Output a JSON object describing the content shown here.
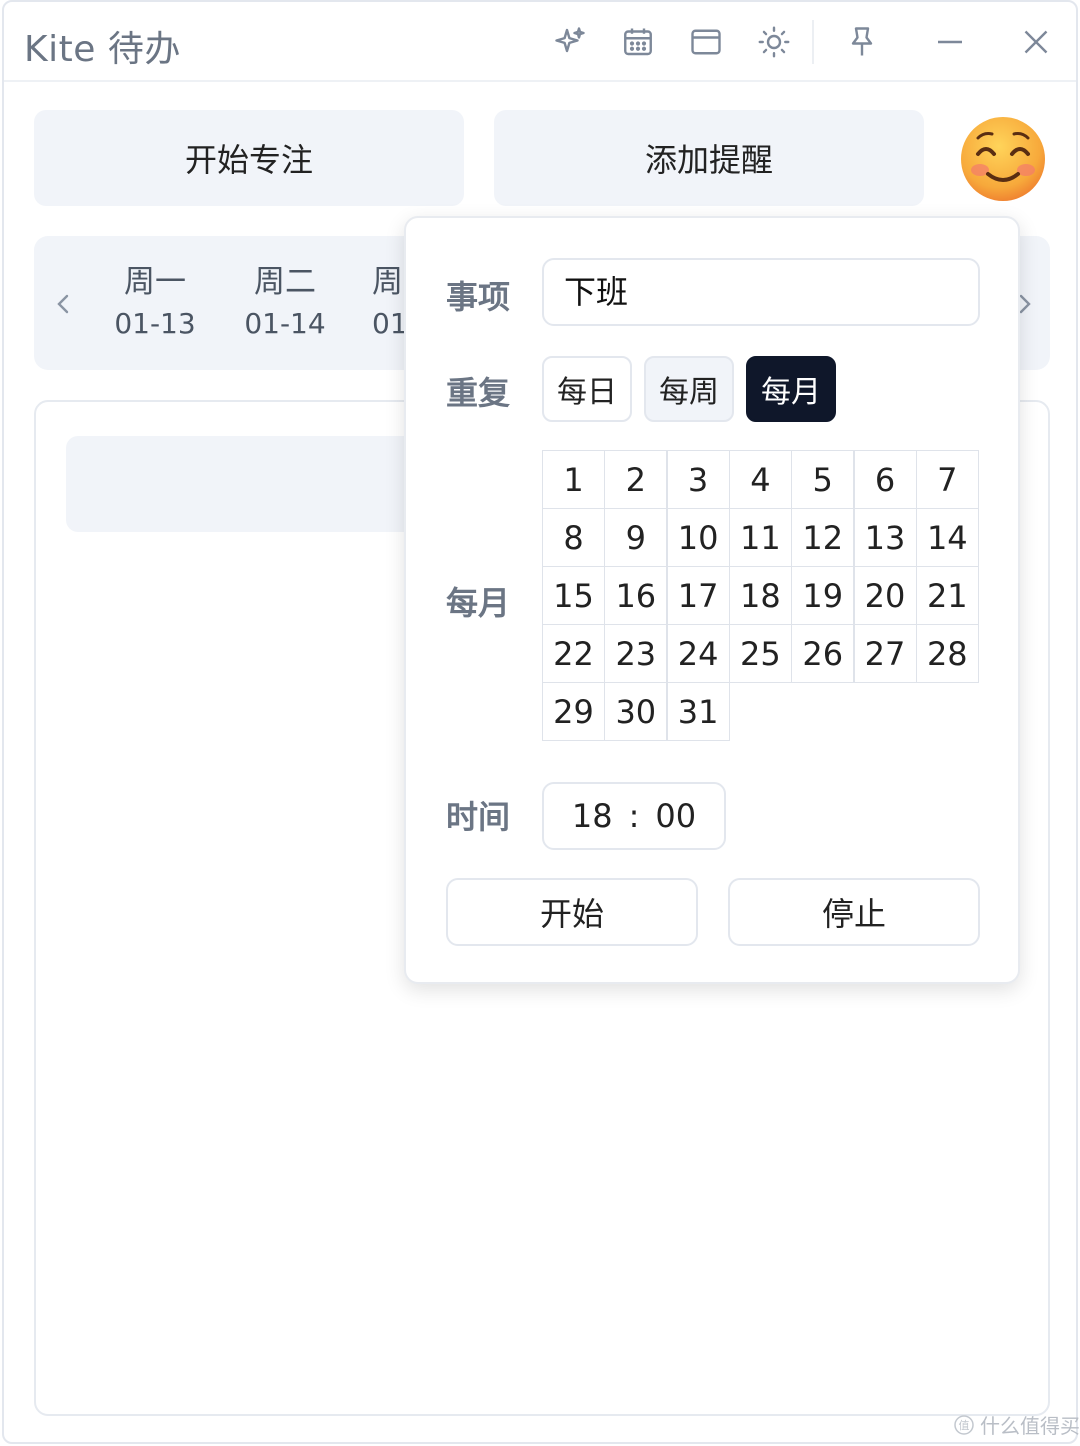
{
  "app": {
    "title": "Kite 待办"
  },
  "titlebar": {
    "icons": [
      "sparkle-icon",
      "calendar-icon",
      "window-icon",
      "sun-icon",
      "pin-icon",
      "minimize-icon",
      "close-icon"
    ]
  },
  "actions": {
    "focus_label": "开始专注",
    "add_reminder_label": "添加提醒"
  },
  "week": {
    "days": [
      {
        "name": "周一",
        "date": "01-13"
      },
      {
        "name": "周二",
        "date": "01-14"
      },
      {
        "name": "周",
        "date": "01"
      }
    ]
  },
  "popup": {
    "item_label": "事项",
    "item_value": "下班",
    "repeat_label": "重复",
    "repeat_options": [
      "每日",
      "每周",
      "每月"
    ],
    "repeat_selected": "每月",
    "monthly_label": "每月",
    "month_days": [
      "1",
      "2",
      "3",
      "4",
      "5",
      "6",
      "7",
      "8",
      "9",
      "10",
      "11",
      "12",
      "13",
      "14",
      "15",
      "16",
      "17",
      "18",
      "19",
      "20",
      "21",
      "22",
      "23",
      "24",
      "25",
      "26",
      "27",
      "28",
      "29",
      "30",
      "31"
    ],
    "time_label": "时间",
    "time_hour": "18",
    "time_sep": ":",
    "time_minute": "00",
    "start_label": "开始",
    "stop_label": "停止"
  },
  "watermark": "什么值得买",
  "colors": {
    "accent_dark": "#0f172a",
    "panel_bg": "#f1f4f9",
    "muted_text": "#6b7584"
  }
}
